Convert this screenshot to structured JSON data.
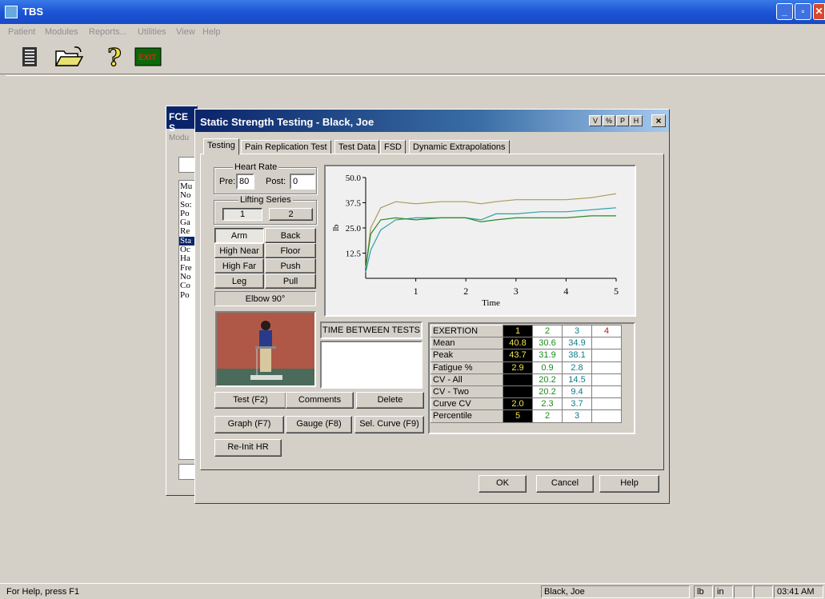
{
  "app": {
    "title": "TBS"
  },
  "menu": [
    "Patient",
    "Modules",
    "Reports...",
    "Utilities",
    "View",
    "Help"
  ],
  "toolbar": {
    "exit_label": "EXIT"
  },
  "status": {
    "help": "For Help, press F1",
    "patient": "Black, Joe",
    "unit_weight": "lb",
    "unit_length": "in",
    "time": "03:41 AM"
  },
  "back_window": {
    "title": "FCE S",
    "menu": "Modu",
    "list": [
      "Mu",
      "No",
      "So:",
      "Po",
      "Ga",
      "Re",
      "Sta",
      "Oc",
      "Ha",
      "Fre",
      "No",
      "Co",
      "Po"
    ],
    "selected_index": 6
  },
  "dialog": {
    "title": "Static Strength Testing - Black, Joe",
    "title_buttons": [
      "V",
      "%",
      "P",
      "H"
    ],
    "close": "×",
    "tabs": [
      "Testing",
      "Pain Replication Test",
      "Test Data",
      "FSD",
      "Dynamic Extrapolations"
    ],
    "active_tab": 0,
    "heart_rate": {
      "label": "Heart Rate",
      "pre_label": "Pre:",
      "pre_value": "80",
      "post_label": "Post:",
      "post_value": "0"
    },
    "lifting_series": {
      "label": "Lifting Series",
      "buttons": [
        "1",
        "2"
      ]
    },
    "positions": [
      "Arm",
      "Back",
      "High Near",
      "Floor",
      "High Far",
      "Push",
      "Leg",
      "Pull"
    ],
    "position_detail": "Elbow 90°",
    "time_between_tests": "TIME BETWEEN TESTS",
    "buttons": {
      "test": "Test (F2)",
      "comments": "Comments",
      "delete": "Delete",
      "graph": "Graph (F7)",
      "gauge": "Gauge (F8)",
      "sel_curve": "Sel. Curve (F9)",
      "reinit": "Re-Init HR",
      "ok": "OK",
      "cancel": "Cancel",
      "help": "Help"
    },
    "grid": {
      "header_label": "EXERTION",
      "exertions": [
        "1",
        "2",
        "3",
        "4"
      ],
      "rows": [
        {
          "label": "Mean",
          "values": [
            "40.8",
            "30.6",
            "34.9",
            ""
          ]
        },
        {
          "label": "Peak",
          "values": [
            "43.7",
            "31.9",
            "38.1",
            ""
          ]
        },
        {
          "label": "Fatigue %",
          "values": [
            "2.9",
            "0.9",
            "2.8",
            ""
          ]
        },
        {
          "label": "CV - All",
          "values": [
            "",
            "20.2",
            "14.5",
            ""
          ]
        },
        {
          "label": "CV - Two",
          "values": [
            "",
            "20.2",
            "9.4",
            ""
          ]
        },
        {
          "label": "Curve CV",
          "values": [
            "2.0",
            "2.3",
            "3.7",
            ""
          ]
        },
        {
          "label": "Percentile",
          "values": [
            "5",
            "2",
            "3",
            ""
          ]
        }
      ]
    }
  },
  "chart_data": {
    "type": "line",
    "xlabel": "Time",
    "ylabel": "lb",
    "xlim": [
      0,
      5
    ],
    "ylim": [
      0,
      50
    ],
    "xticks": [
      "1",
      "2",
      "3",
      "4",
      "5"
    ],
    "yticks": [
      "12.5",
      "25.0",
      "37.5",
      "50.0"
    ],
    "series": [
      {
        "color": "#a89a5a",
        "x": [
          0,
          0.1,
          0.3,
          0.6,
          1.0,
          1.5,
          2.0,
          2.3,
          2.6,
          3.0,
          3.5,
          4.0,
          4.5,
          5.0
        ],
        "y": [
          5,
          25,
          35,
          38,
          37,
          38,
          38,
          37,
          38,
          39,
          39,
          39,
          40,
          42
        ]
      },
      {
        "color": "#2aa0a8",
        "x": [
          0,
          0.1,
          0.3,
          0.6,
          1.0,
          1.5,
          2.0,
          2.3,
          2.6,
          3.0,
          3.5,
          4.0,
          4.5,
          5.0
        ],
        "y": [
          3,
          14,
          24,
          29,
          30,
          30,
          30,
          29,
          32,
          32,
          33,
          33,
          34,
          35
        ]
      },
      {
        "color": "#2a8a2a",
        "x": [
          0,
          0.1,
          0.3,
          0.6,
          1.0,
          1.5,
          2.0,
          2.3,
          2.6,
          3.0,
          3.5,
          4.0,
          4.5,
          5.0
        ],
        "y": [
          5,
          22,
          29,
          30,
          29,
          30,
          30,
          28,
          29,
          30,
          30,
          30,
          31,
          31
        ]
      }
    ]
  }
}
